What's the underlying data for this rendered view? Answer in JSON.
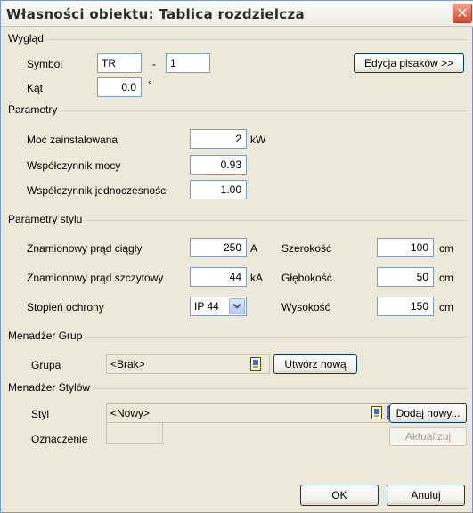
{
  "window": {
    "title": "Własności obiektu: Tablica rozdzielcza",
    "close_label": "✕"
  },
  "wyglad": {
    "group_label": "Wygląd",
    "symbol_label": "Symbol",
    "symbol_prefix": "TR",
    "symbol_separator": "-",
    "symbol_number": "1",
    "edit_pens_button": "Edycja pisaków >>",
    "angle_label": "Kąt",
    "angle_value": "0.0",
    "angle_unit": "°"
  },
  "parametry": {
    "group_label": "Parametry",
    "power_label": "Moc zainstalowana",
    "power_value": "2",
    "power_unit": "kW",
    "power_factor_label": "Współczynnik mocy",
    "power_factor_value": "0.93",
    "simultaneity_label": "Współczynnik jednoczesności",
    "simultaneity_value": "1.00"
  },
  "parametry_stylu": {
    "group_label": "Parametry stylu",
    "rated_current_label": "Znamionowy prąd ciągły",
    "rated_current_value": "250",
    "rated_current_unit": "A",
    "peak_current_label": "Znamionowy prąd szczytowy",
    "peak_current_value": "44",
    "peak_current_unit": "kA",
    "protection_label": "Stopień ochrony",
    "protection_selected": "IP 44",
    "width_label": "Szerokość",
    "width_value": "100",
    "width_unit": "cm",
    "depth_label": "Głębokość",
    "depth_value": "50",
    "depth_unit": "cm",
    "height_label": "Wysokość",
    "height_value": "150",
    "height_unit": "cm"
  },
  "menadzer_grup": {
    "group_label": "Menadżer Grup",
    "group_field_label": "Grupa",
    "group_value": "<Brak>",
    "create_new_button": "Utwórz nową"
  },
  "menadzer_stylow": {
    "group_label": "Menadżer Stylów",
    "style_label": "Styl",
    "style_value": "<Nowy>",
    "add_new_button": "Dodaj nowy...",
    "designation_label": "Oznaczenie",
    "designation_value": "",
    "update_button": "Aktualizuj"
  },
  "footer": {
    "ok_button": "OK",
    "cancel_button": "Anuluj"
  },
  "colors": {
    "dialog_bg": "#ece9d8",
    "field_border": "#7f9db9",
    "button_border": "#003c74",
    "close_red": "#d9462a"
  }
}
